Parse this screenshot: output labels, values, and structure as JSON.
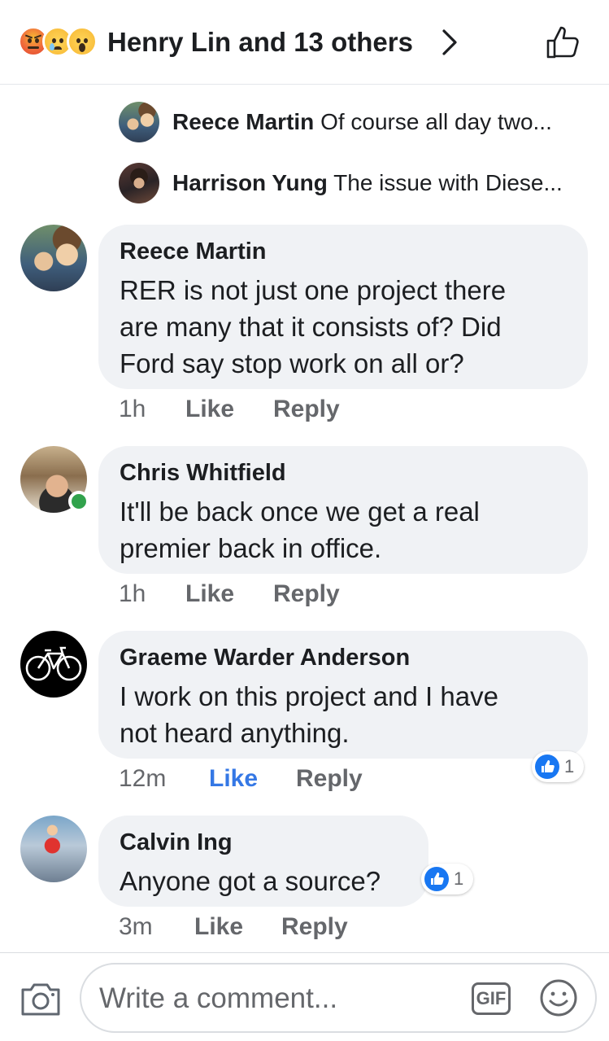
{
  "header": {
    "reactions": [
      "angry-icon",
      "sad-icon",
      "wow-icon"
    ],
    "title": "Henry Lin and 13 others"
  },
  "mini_replies": [
    {
      "name": "Reece Martin",
      "preview": "Of course all day two..."
    },
    {
      "name": "Harrison Yung",
      "preview": "The issue with Diese..."
    }
  ],
  "comments": [
    {
      "author": "Reece Martin",
      "lines": [
        "RER is not just one project there",
        "are many that it consists of? Did",
        "Ford say stop work on all or?"
      ],
      "time": "1h",
      "like": "Like",
      "reply": "Reply"
    },
    {
      "author": "Chris Whitfield",
      "lines": [
        "It'll be back once we get a real",
        "premier back in office."
      ],
      "time": "1h",
      "like": "Like",
      "reply": "Reply",
      "online": true
    },
    {
      "author": "Graeme Warder Anderson",
      "lines": [
        "I work on this project and I have",
        "not heard anything."
      ],
      "time": "12m",
      "like": "Like",
      "reply": "Reply",
      "liked": true,
      "reaction_count": "1"
    },
    {
      "author": "Calvin Ing",
      "lines": [
        "Anyone got a source?"
      ],
      "time": "3m",
      "like": "Like",
      "reply": "Reply",
      "reaction_count": "1"
    }
  ],
  "composer": {
    "placeholder": "Write a comment...",
    "gif_label": "GIF"
  },
  "colors": {
    "accent": "#3578e5",
    "bubble": "#f0f2f5",
    "online": "#31a24c"
  }
}
